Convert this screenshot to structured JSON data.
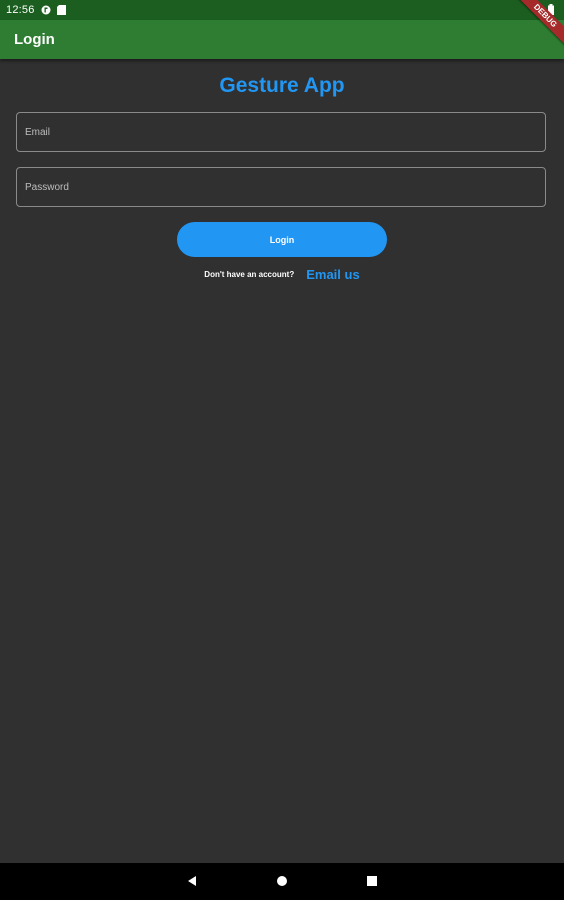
{
  "status_bar": {
    "time": "12:56",
    "icons": [
      "app-notification-icon",
      "sd-card-icon",
      "wifi-icon",
      "battery-icon"
    ]
  },
  "app_bar": {
    "title": "Login",
    "color": "#2e7d32",
    "debug_label": "DEBUG"
  },
  "main": {
    "app_title": "Gesture App",
    "email": {
      "placeholder": "Email",
      "value": ""
    },
    "password": {
      "placeholder": "Password",
      "value": ""
    },
    "login_label": "Login",
    "signup_prompt": "Don't have an account?",
    "email_us_label": "Email us"
  },
  "nav_bar": {
    "buttons": [
      "back-icon",
      "home-icon",
      "recents-icon"
    ]
  },
  "colors": {
    "accent": "#2196f3",
    "background": "#303030",
    "status_bar": "#1b5e20"
  }
}
